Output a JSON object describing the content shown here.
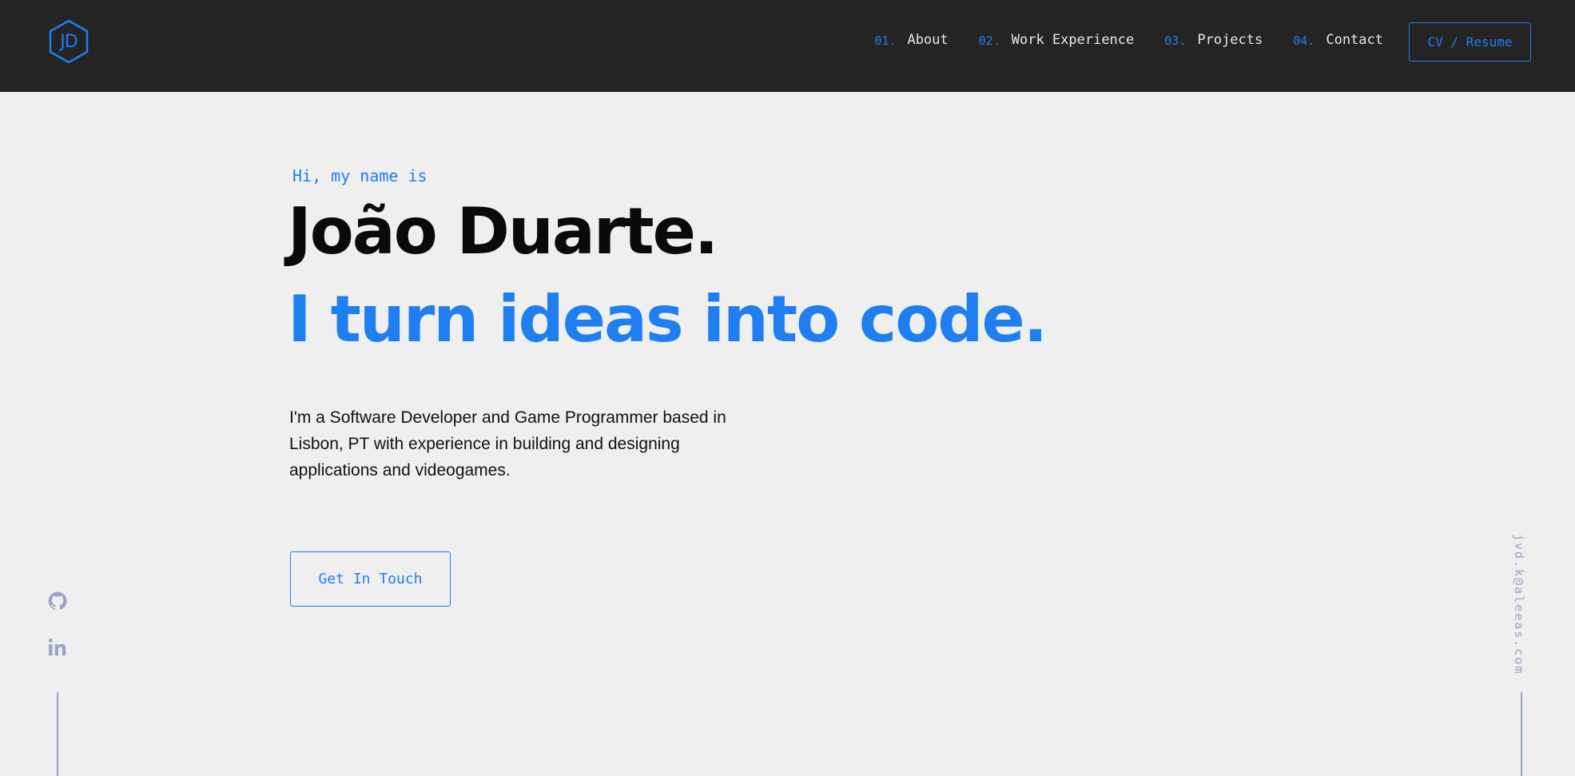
{
  "header": {
    "logo_text": "JD",
    "nav": [
      {
        "num": "01.",
        "label": "About"
      },
      {
        "num": "02.",
        "label": "Work Experience"
      },
      {
        "num": "03.",
        "label": "Projects"
      },
      {
        "num": "04.",
        "label": "Contact"
      }
    ],
    "resume_label": "CV / Resume"
  },
  "hero": {
    "greeting": "Hi, my name is",
    "name": "João Duarte.",
    "tagline": "I turn ideas into code.",
    "intro": "I'm a Software Developer and Game Programmer based in Lisbon, PT with experience in building and designing applications and videogames.",
    "cta_label": "Get In Touch"
  },
  "socials": [
    {
      "icon": "github-icon"
    },
    {
      "icon": "linkedin-icon"
    }
  ],
  "email": "jvd.k@aleeas.com",
  "colors": {
    "accent": "#1f7ef0",
    "header_bg": "#242424",
    "page_bg": "#efefef",
    "muted": "#9aa3c8"
  }
}
